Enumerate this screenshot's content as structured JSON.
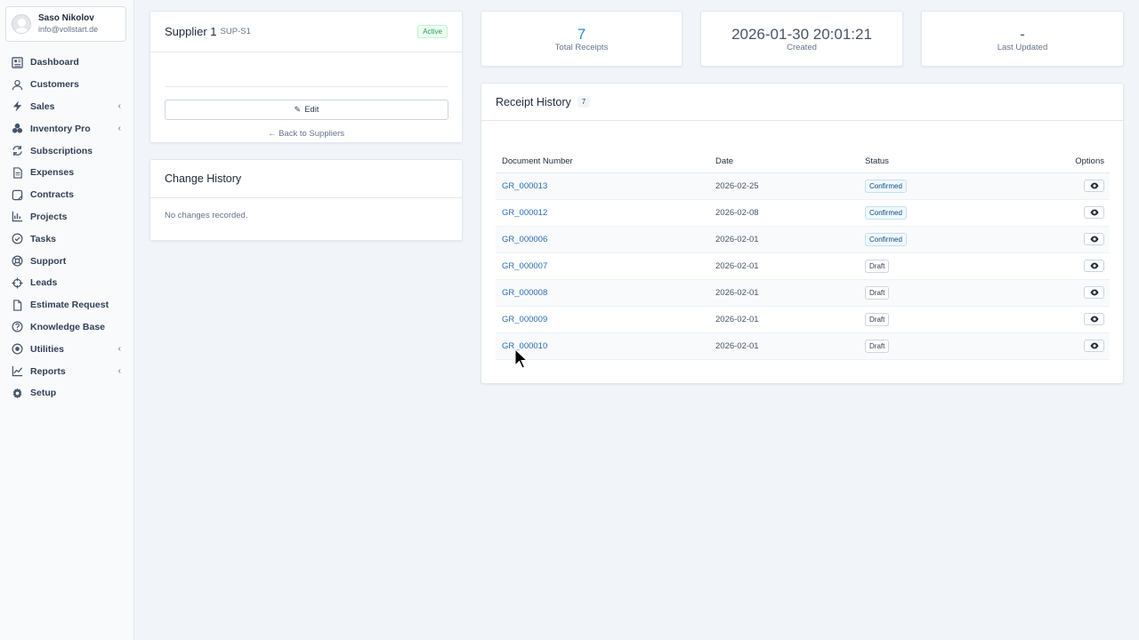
{
  "user": {
    "name": "Saso Nikolov",
    "email": "info@vollstart.de"
  },
  "sidebar": {
    "items": [
      {
        "label": "Dashboard",
        "icon": "dashboard-icon",
        "chevron": false
      },
      {
        "label": "Customers",
        "icon": "user-icon",
        "chevron": false
      },
      {
        "label": "Sales",
        "icon": "bolt-icon",
        "chevron": true
      },
      {
        "label": "Inventory Pro",
        "icon": "boxes-icon",
        "chevron": true
      },
      {
        "label": "Subscriptions",
        "icon": "refresh-icon",
        "chevron": false
      },
      {
        "label": "Expenses",
        "icon": "file-icon",
        "chevron": false
      },
      {
        "label": "Contracts",
        "icon": "contract-icon",
        "chevron": false
      },
      {
        "label": "Projects",
        "icon": "chart-icon",
        "chevron": false
      },
      {
        "label": "Tasks",
        "icon": "check-circle-icon",
        "chevron": false
      },
      {
        "label": "Support",
        "icon": "lifebuoy-icon",
        "chevron": false
      },
      {
        "label": "Leads",
        "icon": "crosshair-icon",
        "chevron": false
      },
      {
        "label": "Estimate Request",
        "icon": "document-icon",
        "chevron": false
      },
      {
        "label": "Knowledge Base",
        "icon": "question-icon",
        "chevron": false
      },
      {
        "label": "Utilities",
        "icon": "record-icon",
        "chevron": true
      },
      {
        "label": "Reports",
        "icon": "line-chart-icon",
        "chevron": true
      },
      {
        "label": "Setup",
        "icon": "gear-icon",
        "chevron": false
      }
    ]
  },
  "supplier": {
    "name": "Supplier 1",
    "code": "SUP-S1",
    "status": "Active",
    "edit_label": "Edit",
    "back_label": "Back to Suppliers"
  },
  "history": {
    "title": "Change History",
    "empty_text": "No changes recorded."
  },
  "stats": {
    "receipts": {
      "value": "7",
      "label": "Total Receipts"
    },
    "created": {
      "value": "2026-01-30 20:01:21",
      "label": "Created"
    },
    "updated": {
      "value": "-",
      "label": "Last Updated"
    }
  },
  "receipts": {
    "title": "Receipt History",
    "count": "7",
    "columns": {
      "doc": "Document Number",
      "date": "Date",
      "status": "Status",
      "options": "Options"
    },
    "rows": [
      {
        "doc": "GR_000013",
        "date": "2026-02-25",
        "status": "Confirmed"
      },
      {
        "doc": "GR_000012",
        "date": "2026-02-08",
        "status": "Confirmed"
      },
      {
        "doc": "GR_000006",
        "date": "2026-02-01",
        "status": "Confirmed"
      },
      {
        "doc": "GR_000007",
        "date": "2026-02-01",
        "status": "Draft"
      },
      {
        "doc": "GR_000008",
        "date": "2026-02-01",
        "status": "Draft"
      },
      {
        "doc": "GR_000009",
        "date": "2026-02-01",
        "status": "Draft"
      },
      {
        "doc": "GR_000010",
        "date": "2026-02-01",
        "status": "Draft"
      }
    ]
  },
  "colors": {
    "link": "#2b6cb0",
    "active": "#16a34a",
    "stat_accent": "#2b8ccd"
  }
}
